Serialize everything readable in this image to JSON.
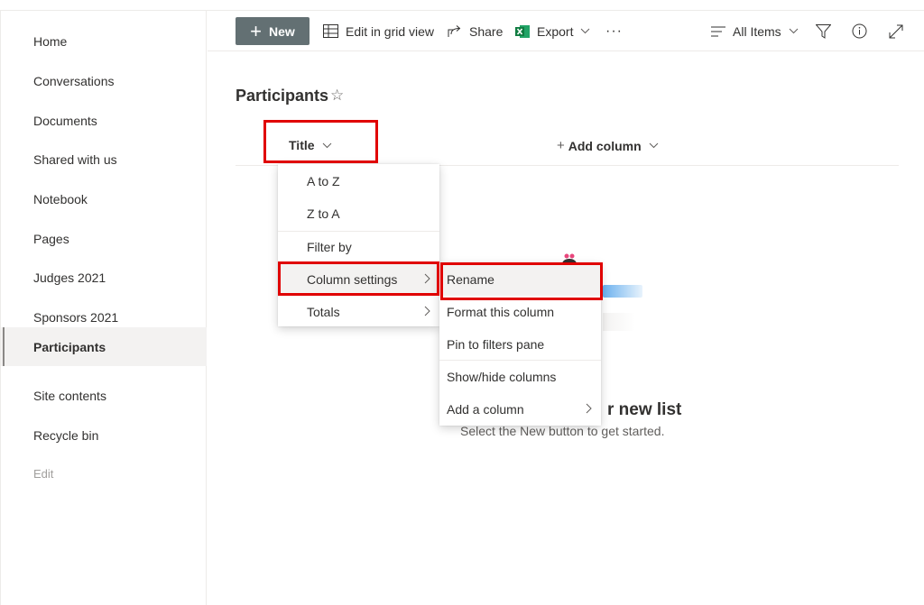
{
  "nav": {
    "items": [
      {
        "label": "Home"
      },
      {
        "label": "Conversations"
      },
      {
        "label": "Documents"
      },
      {
        "label": "Shared with us"
      },
      {
        "label": "Notebook"
      },
      {
        "label": "Pages"
      },
      {
        "label": "Judges 2021"
      },
      {
        "label": "Sponsors 2021"
      },
      {
        "label": "Participants",
        "selected": true
      },
      {
        "label": "Site contents"
      },
      {
        "label": "Recycle bin"
      },
      {
        "label": "Edit"
      }
    ]
  },
  "toolbar": {
    "new_label": "New",
    "grid_label": "Edit in grid view",
    "share_label": "Share",
    "export_label": "Export",
    "more_label": "···",
    "view_label": "All Items"
  },
  "list": {
    "title": "Participants",
    "column_title": "Title",
    "add_column": "Add column"
  },
  "column_menu": {
    "items": [
      "A to Z",
      "Z to A",
      "Filter by",
      "Column settings",
      "Totals"
    ]
  },
  "settings_submenu": {
    "items": [
      "Rename",
      "Format this column",
      "Pin to filters pane",
      "Show/hide columns",
      "Add a column"
    ]
  },
  "empty_state": {
    "title_fragment": "r new list",
    "subtitle": "Select the New button to get started."
  },
  "colors": {
    "new_button": "#637073",
    "highlight": "#e00000",
    "excel_green": "#107c41"
  }
}
